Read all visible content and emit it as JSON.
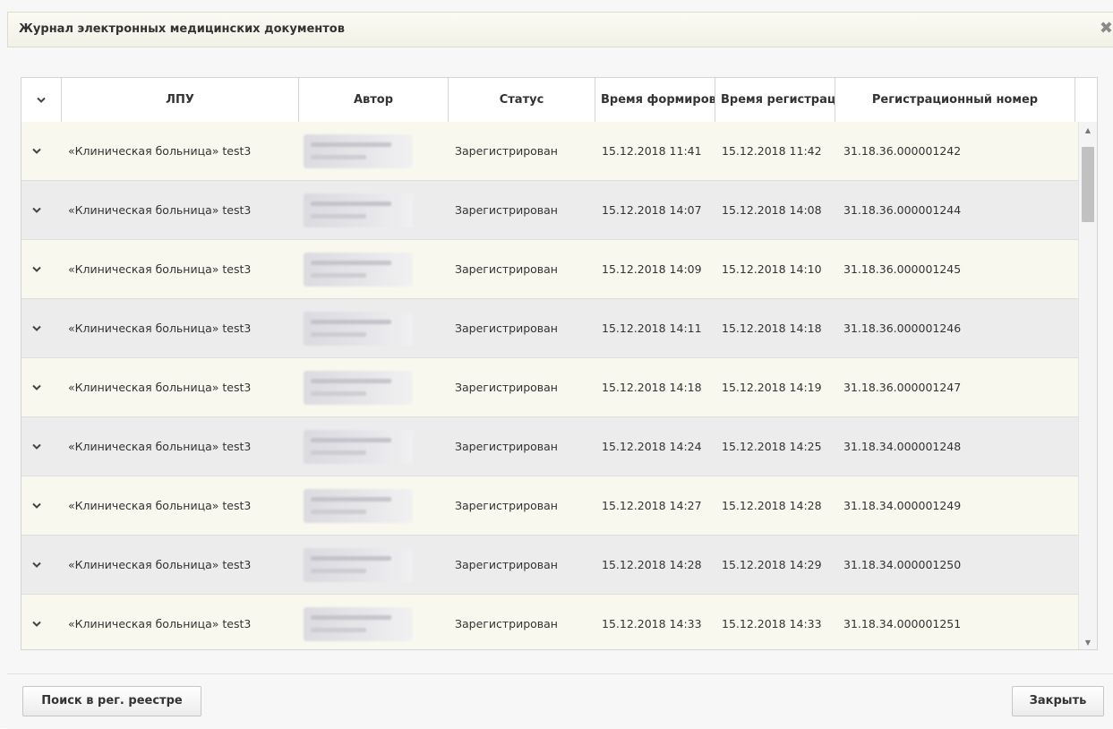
{
  "dialog": {
    "title": "Журнал электронных медицинских документов",
    "close_glyph": "✖"
  },
  "table": {
    "columns": [
      "",
      "ЛПУ",
      "Автор",
      "Статус",
      "Время формирования",
      "Время регистрации",
      "Регистрационный номер"
    ],
    "rows": [
      {
        "lpu": "«Клиническая больница» test3",
        "status": "Зарегистрирован",
        "formed": "15.12.2018 11:41",
        "registered": "15.12.2018 11:42",
        "reg_number": "31.18.36.000001242"
      },
      {
        "lpu": "«Клиническая больница» test3",
        "status": "Зарегистрирован",
        "formed": "15.12.2018 14:07",
        "registered": "15.12.2018 14:08",
        "reg_number": "31.18.36.000001244"
      },
      {
        "lpu": "«Клиническая больница» test3",
        "status": "Зарегистрирован",
        "formed": "15.12.2018 14:09",
        "registered": "15.12.2018 14:10",
        "reg_number": "31.18.36.000001245"
      },
      {
        "lpu": "«Клиническая больница» test3",
        "status": "Зарегистрирован",
        "formed": "15.12.2018 14:11",
        "registered": "15.12.2018 14:18",
        "reg_number": "31.18.36.000001246"
      },
      {
        "lpu": "«Клиническая больница» test3",
        "status": "Зарегистрирован",
        "formed": "15.12.2018 14:18",
        "registered": "15.12.2018 14:19",
        "reg_number": "31.18.36.000001247"
      },
      {
        "lpu": "«Клиническая больница» test3",
        "status": "Зарегистрирован",
        "formed": "15.12.2018 14:24",
        "registered": "15.12.2018 14:25",
        "reg_number": "31.18.34.000001248"
      },
      {
        "lpu": "«Клиническая больница» test3",
        "status": "Зарегистрирован",
        "formed": "15.12.2018 14:27",
        "registered": "15.12.2018 14:28",
        "reg_number": "31.18.34.000001249"
      },
      {
        "lpu": "«Клиническая больница» test3",
        "status": "Зарегистрирован",
        "formed": "15.12.2018 14:28",
        "registered": "15.12.2018 14:29",
        "reg_number": "31.18.34.000001250"
      },
      {
        "lpu": "«Клиническая больница» test3",
        "status": "Зарегистрирован",
        "formed": "15.12.2018 14:33",
        "registered": "15.12.2018 14:33",
        "reg_number": "31.18.34.000001251"
      }
    ]
  },
  "footer": {
    "search_button": "Поиск в рег. реестре",
    "close_button": "Закрыть"
  },
  "icons": {
    "expand": "chevron-down-icon",
    "close": "close-icon"
  }
}
